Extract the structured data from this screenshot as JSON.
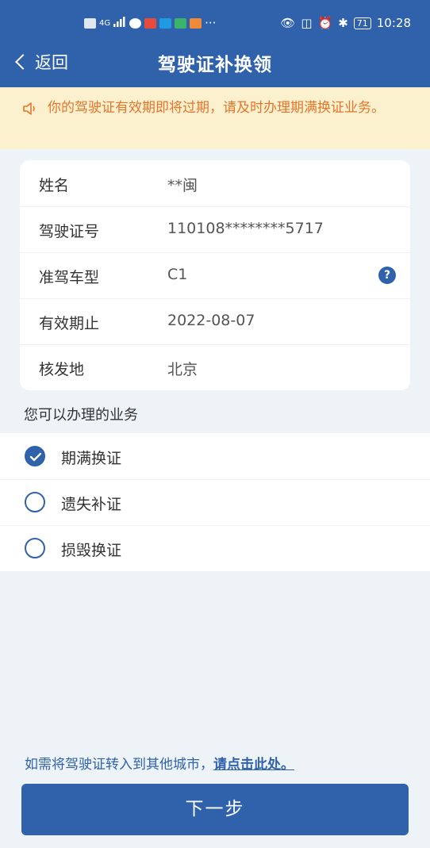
{
  "statusbar": {
    "network": "4G",
    "battery": "71",
    "time": "10:28"
  },
  "header": {
    "back_label": "返回",
    "title": "驾驶证补换领"
  },
  "notice": {
    "text": "你的驾驶证有效期即将过期，请及时办理期满换证业务。"
  },
  "info": {
    "rows": [
      {
        "label": "姓名",
        "value": "**闽"
      },
      {
        "label": "驾驶证号",
        "value": "110108********5717"
      },
      {
        "label": "准驾车型",
        "value": "C1",
        "help_icon": "?"
      },
      {
        "label": "有效期止",
        "value": "2022-08-07"
      },
      {
        "label": "核发地",
        "value": "北京"
      }
    ]
  },
  "services": {
    "title": "您可以办理的业务",
    "options": [
      {
        "label": "期满换证",
        "checked": true
      },
      {
        "label": "遗失补证",
        "checked": false
      },
      {
        "label": "损毁换证",
        "checked": false
      }
    ]
  },
  "footer": {
    "transfer_text": "如需将驾驶证转入到其他城市，",
    "transfer_link": "请点击此处。",
    "next_button": "下一步"
  },
  "colors": {
    "primary": "#2f62ab",
    "notice_bg": "#fbf1cf",
    "notice_text": "#e5752a",
    "page_bg": "#eef3f7"
  }
}
